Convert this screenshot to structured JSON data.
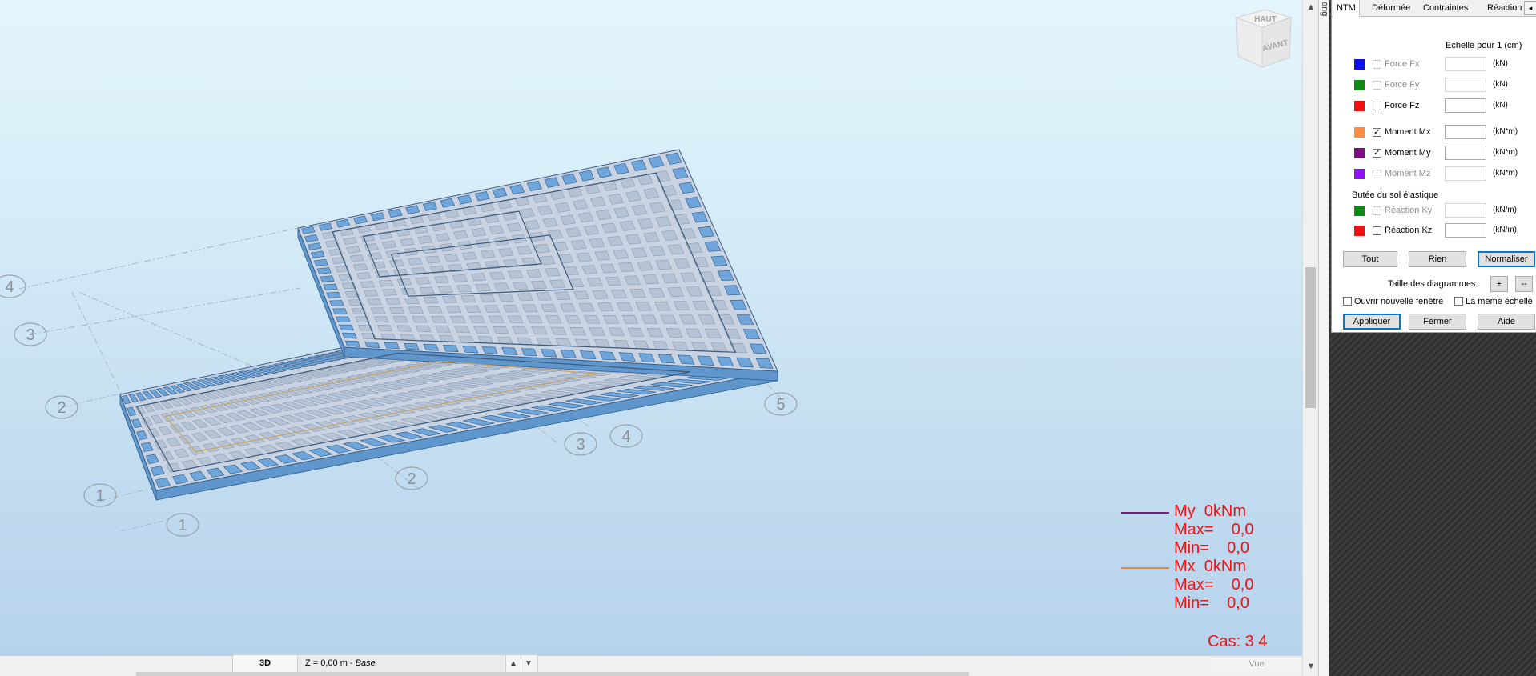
{
  "viewport": {
    "view_cube": {
      "top_label": "HAUT",
      "front_label": "AVANT"
    },
    "axis_labels": [
      {
        "text": "4"
      },
      {
        "text": "3"
      },
      {
        "text": "2"
      },
      {
        "text": "1"
      },
      {
        "text": "1"
      },
      {
        "text": "2"
      },
      {
        "text": "3"
      },
      {
        "text": "4"
      },
      {
        "text": "5"
      }
    ],
    "legend": {
      "entries": [
        {
          "name": "My  0kNm",
          "max": "Max=    0,0",
          "min": "Min=    0,0",
          "color": "#7a1c7c"
        },
        {
          "name": "Mx  0kNm",
          "max": "Max=    0,0",
          "min": "Min=    0,0",
          "color": "#f0823a"
        }
      ],
      "case": "Cas: 3 4"
    }
  },
  "bottombar": {
    "view_label": "3D",
    "level_prefix": "Z = 0,00 m - ",
    "level_name": "Base",
    "vue_label": "Vue"
  },
  "side_strip": {
    "label": "ong"
  },
  "dialog": {
    "tabs": [
      "NTM",
      "Déformée",
      "Contraintes",
      "Réaction"
    ],
    "tab_arrow": "◂",
    "scale_label": "Echelle pour 1  (cm)",
    "rows": [
      {
        "label": "Force Fx",
        "unit": "(kN)",
        "color": "#0a10ee",
        "checked": false,
        "enabled": false
      },
      {
        "label": "Force Fy",
        "unit": "(kN)",
        "color": "#0d8a14",
        "checked": false,
        "enabled": false
      },
      {
        "label": "Force Fz",
        "unit": "(kN)",
        "color": "#f01212",
        "checked": false,
        "enabled": true
      },
      {
        "label": "Moment Mx",
        "unit": "(kN*m)",
        "color": "#fb8c42",
        "checked": true,
        "enabled": true
      },
      {
        "label": "Moment My",
        "unit": "(kN*m)",
        "color": "#7e0e84",
        "checked": true,
        "enabled": true
      },
      {
        "label": "Moment Mz",
        "unit": "(kN*m)",
        "color": "#8e12f4",
        "checked": false,
        "enabled": false
      }
    ],
    "soil_section": "Butée du sol élastique",
    "soil_rows": [
      {
        "label": "Réaction Ky",
        "unit": "(kN/m)",
        "color": "#0d8a14",
        "checked": false,
        "enabled": false
      },
      {
        "label": "Réaction Kz",
        "unit": "(kN/m)",
        "color": "#f01212",
        "checked": false,
        "enabled": true
      }
    ],
    "btn_tout": "Tout",
    "btn_rien": "Rien",
    "btn_normaliser": "Normaliser",
    "taille_label": "Taille des diagrammes:",
    "btn_plus": "+",
    "btn_minus": "--",
    "opt_new_window": "Ouvrir nouvelle fenêtre",
    "opt_same_scale": "La même échelle",
    "btn_appliquer": "Appliquer",
    "btn_fermer": "Fermer",
    "btn_aide": "Aide"
  }
}
